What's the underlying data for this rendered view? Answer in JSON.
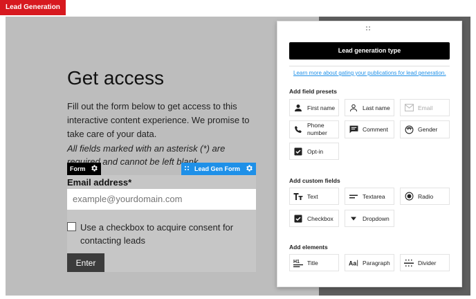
{
  "app_tag": "Lead Generation",
  "page": {
    "heading": "Get access",
    "intro": "Fill out the form below to get access to this interactive content experience. We promise to take care of your data.",
    "note": "All fields marked with an asterisk (*) are required and cannot be left blank."
  },
  "form_tab": {
    "label": "Form"
  },
  "leadgen_tab": {
    "label": "Lead Gen Form"
  },
  "form": {
    "email_label": "Email address*",
    "email_placeholder": "example@yourdomain.com",
    "consent_text": "Use a checkbox to acquire consent for contacting leads",
    "submit_label": "Enter"
  },
  "panel": {
    "type_button": "Lead generation type",
    "learn_link": "Learn more about gating your publications for lead generation.",
    "sections": {
      "presets_title": "Add field presets",
      "custom_title": "Add custom fields",
      "elements_title": "Add elements"
    },
    "presets": [
      {
        "label": "First name",
        "icon": "person-filled-icon"
      },
      {
        "label": "Last name",
        "icon": "person-outline-icon"
      },
      {
        "label": "Email",
        "icon": "envelope-icon",
        "disabled": true
      },
      {
        "label": "Phone number",
        "icon": "phone-icon"
      },
      {
        "label": "Comment",
        "icon": "comment-icon"
      },
      {
        "label": "Gender",
        "icon": "face-icon"
      },
      {
        "label": "Opt-in",
        "icon": "checkbox-icon"
      }
    ],
    "custom": [
      {
        "label": "Text",
        "icon": "text-icon"
      },
      {
        "label": "Textarea",
        "icon": "textarea-icon"
      },
      {
        "label": "Radio",
        "icon": "radio-icon"
      },
      {
        "label": "Checkbox",
        "icon": "checkbox-icon"
      },
      {
        "label": "Dropdown",
        "icon": "dropdown-icon"
      }
    ],
    "elements": [
      {
        "label": "Title",
        "icon": "title-icon"
      },
      {
        "label": "Paragraph",
        "icon": "paragraph-icon"
      },
      {
        "label": "Divider",
        "icon": "divider-icon"
      }
    ]
  },
  "colors": {
    "brand_red": "#d7191f",
    "accent_blue": "#1e90e8",
    "canvas_gray": "#bdbdbd"
  }
}
